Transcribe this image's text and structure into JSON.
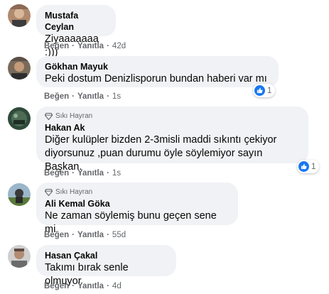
{
  "comments": [
    {
      "name": "Mustafa Ceylan",
      "text": "Ziyaaaaaaa :)))",
      "like": "Beğen",
      "reply": "Yanıtla",
      "time": "42d",
      "badge": "",
      "reactions": ""
    },
    {
      "name": "Gökhan Mayuk",
      "text": "Peki dostum Denizlisporun bundan haberi var mı",
      "like": "Beğen",
      "reply": "Yanıtla",
      "time": "1s",
      "badge": "",
      "reactions": "1"
    },
    {
      "name": "Hakan Ak",
      "text": "Diğer kulüpler bizden 2-3misli maddi sıkıntı çekiyor\ndiyorsunuz ,puan durumu öyle söylemiyor sayın Başkan.",
      "like": "Beğen",
      "reply": "Yanıtla",
      "time": "1s",
      "badge": "Sıkı Hayran",
      "reactions": "1"
    },
    {
      "name": "Ali Kemal Göka",
      "text": "Ne zaman söylemiş bunu geçen sene mi",
      "like": "Beğen",
      "reply": "Yanıtla",
      "time": "55d",
      "badge": "Sıkı Hayran",
      "reactions": ""
    },
    {
      "name": "Hasan Çakal",
      "text": "Takımı bırak senle olmuyor",
      "like": "Beğen",
      "reply": "Yanıtla",
      "time": "4d",
      "badge": "",
      "reactions": ""
    }
  ],
  "colors": {
    "bubble": "#f0f2f5",
    "meta": "#65676b",
    "like_blue": "#1877f2"
  }
}
